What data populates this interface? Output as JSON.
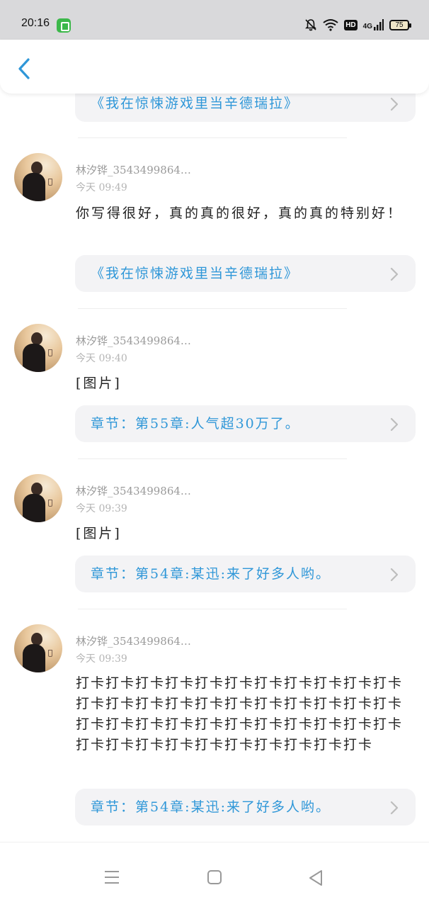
{
  "status_bar": {
    "time": "20:16",
    "network": "4G",
    "hd": "HD",
    "battery": "75",
    "icons": [
      "app-icon",
      "bell-muted-icon",
      "wifi-icon",
      "hd-icon",
      "signal-icon",
      "battery-icon"
    ]
  },
  "header": {
    "back_icon": "chevron-left-icon",
    "accent": "#2f97d8"
  },
  "top_card": {
    "text": "《我在惊悚游戏里当辛德瑞拉》"
  },
  "posts": [
    {
      "username": "林汐铧_3543499864…",
      "time": "今天 09:49",
      "content": "你写得很好，真的真的很好，真的真的特别好！",
      "link": "《我在惊悚游戏里当辛德瑞拉》"
    },
    {
      "username": "林汐铧_3543499864…",
      "time": "今天 09:40",
      "content": "[图片]",
      "link": "章节：第55章:人气超30万了。"
    },
    {
      "username": "林汐铧_3543499864…",
      "time": "今天 09:39",
      "content": "[图片]",
      "link": "章节：第54章:某迅:来了好多人哟。"
    },
    {
      "username": "林汐铧_3543499864…",
      "time": "今天 09:39",
      "content": "打卡打卡打卡打卡打卡打卡打卡打卡打卡打卡打卡打卡打卡打卡打卡打卡打卡打卡打卡打卡打卡打卡打卡打卡打卡打卡打卡打卡打卡打卡打卡打卡打卡打卡打卡打卡打卡打卡打卡打卡打卡打卡打卡",
      "link": "章节：第54章:某迅:来了好多人哟。"
    }
  ],
  "nav": {
    "icons": [
      "menu-icon",
      "home-square-icon",
      "back-triangle-icon"
    ]
  }
}
